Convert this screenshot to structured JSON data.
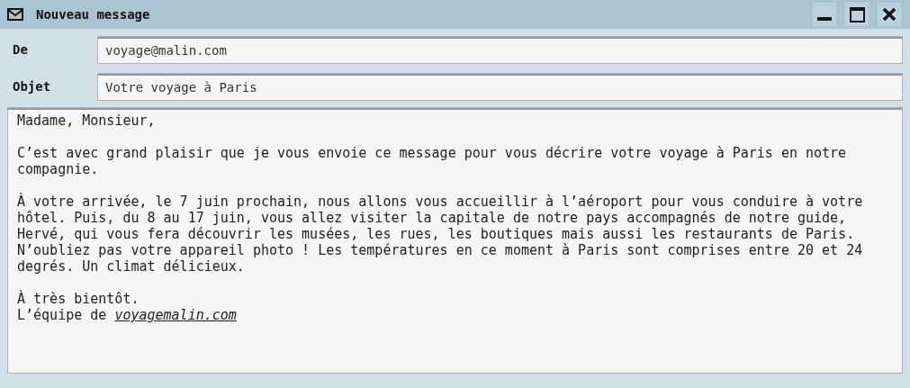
{
  "window": {
    "title": "Nouveau message"
  },
  "fields": [
    {
      "label": "De",
      "value": "voyage@malin.com"
    },
    {
      "label": "Objet",
      "value": "Votre voyage à Paris"
    }
  ],
  "body": {
    "paragraphs": [
      "Madame, Monsieur,",
      "C’est avec grand plaisir que je vous envoie ce message pour vous décrire votre voyage à Paris en notre compagnie.",
      "À votre arrivée, le 7 juin prochain, nous allons vous accueillir à l’aéroport pour vous conduire à votre hôtel. Puis, du 8 au 17 juin, vous allez visiter la capitale de notre pays accompagnés de notre guide, Hervé, qui vous fera découvrir les musées, les rues, les boutiques mais aussi les restaurants de Paris. N’oubliez pas votre appareil photo ! Les températures en ce moment à Paris sont comprises entre 20 et 24 degrés. Un climat délicieux."
    ],
    "closing": "À très bientôt.",
    "signature": {
      "text": "L’équipe de",
      "link": "voyagemalin.com"
    }
  }
}
